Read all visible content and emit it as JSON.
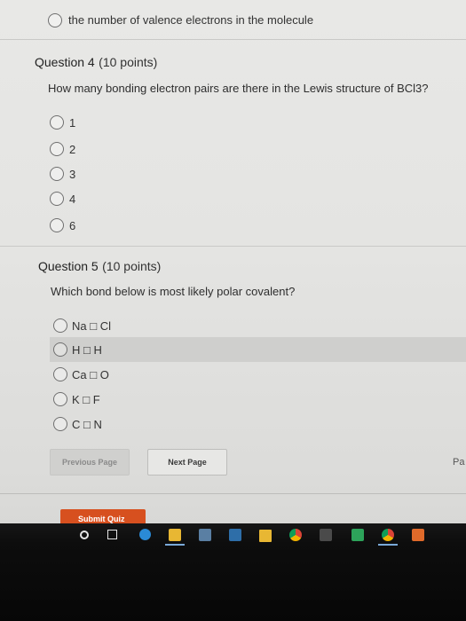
{
  "previous_option": {
    "text": "the number of valence electrons in the molecule"
  },
  "question4": {
    "title": "Question 4",
    "points": "(10 points)",
    "text": "How many bonding electron pairs are there in the Lewis structure of BCl3?",
    "options": [
      "1",
      "2",
      "3",
      "4",
      "6"
    ]
  },
  "question5": {
    "title": "Question 5",
    "points": "(10 points)",
    "text": "Which bond below is most likely polar covalent?",
    "options": [
      "Na □ Cl",
      "H □ H",
      "Ca □ O",
      "K □ F",
      "C □ N"
    ],
    "hovered_index": 1
  },
  "nav": {
    "previous_label": "Previous Page",
    "next_label": "Next Page",
    "page_label": "Pa",
    "submit_label": "Submit Quiz"
  },
  "taskbar": {
    "icons": [
      "start-circle-icon",
      "task-view-icon",
      "edge-browser-icon",
      "file-explorer-icon",
      "calculator-icon",
      "store-icon",
      "mail-icon",
      "chrome-icon",
      "puzzle-app-icon",
      "green-app-icon",
      "chrome-alt-icon",
      "orange-app-icon"
    ]
  },
  "colors": {
    "accent_submit": "#d7501f",
    "hover_row": "#cfcfcd"
  }
}
